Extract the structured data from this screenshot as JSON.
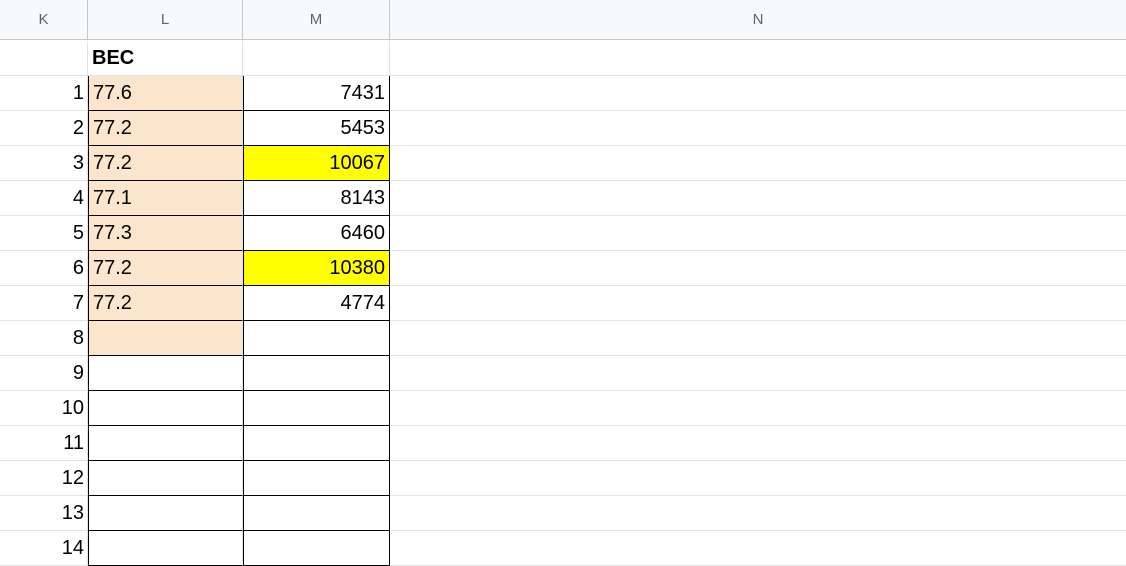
{
  "columns": {
    "k": "K",
    "l": "L",
    "m": "M",
    "n": "N"
  },
  "header_row": {
    "l": "BEC",
    "m": ""
  },
  "rows": [
    {
      "k": "1",
      "l": "77.6",
      "m": "7431",
      "m_highlight": false
    },
    {
      "k": "2",
      "l": "77.2",
      "m": "5453",
      "m_highlight": false
    },
    {
      "k": "3",
      "l": "77.2",
      "m": "10067",
      "m_highlight": true
    },
    {
      "k": "4",
      "l": "77.1",
      "m": "8143",
      "m_highlight": false
    },
    {
      "k": "5",
      "l": "77.3",
      "m": "6460",
      "m_highlight": false
    },
    {
      "k": "6",
      "l": "77.2",
      "m": "10380",
      "m_highlight": true
    },
    {
      "k": "7",
      "l": "77.2",
      "m": "4774",
      "m_highlight": false
    },
    {
      "k": "8",
      "l": "",
      "m": "",
      "m_highlight": false
    },
    {
      "k": "9",
      "l": "",
      "m": "",
      "m_highlight": false
    },
    {
      "k": "10",
      "l": "",
      "m": "",
      "m_highlight": false
    },
    {
      "k": "11",
      "l": "",
      "m": "",
      "m_highlight": false
    },
    {
      "k": "12",
      "l": "",
      "m": "",
      "m_highlight": false
    },
    {
      "k": "13",
      "l": "",
      "m": "",
      "m_highlight": false
    },
    {
      "k": "14",
      "l": "",
      "m": "",
      "m_highlight": false
    }
  ],
  "colors": {
    "peach": "#fce5cd",
    "highlight": "#ffff00",
    "header_bg": "#f8f9fa"
  }
}
